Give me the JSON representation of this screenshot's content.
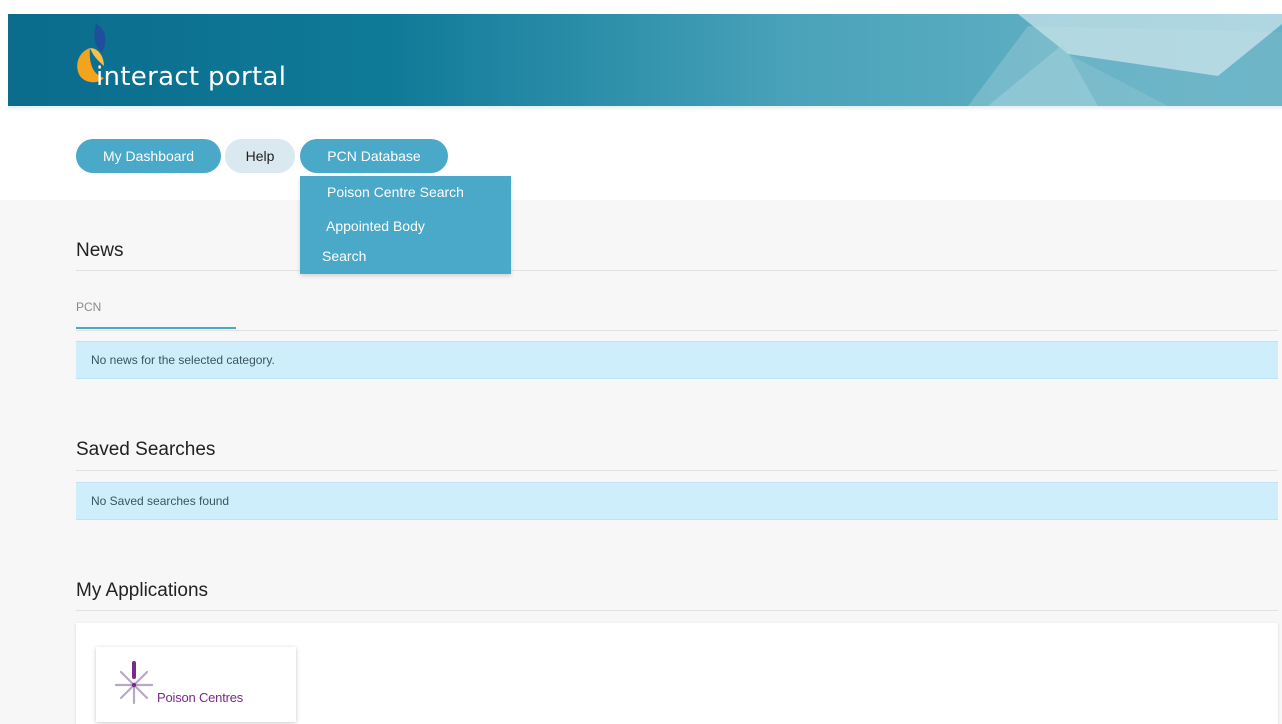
{
  "header": {
    "logo_text": "interact portal",
    "logo_icon": "interact-portal-logo"
  },
  "nav": {
    "items": [
      {
        "label": "My Dashboard"
      },
      {
        "label": "Help"
      },
      {
        "label": "PCN Database"
      }
    ],
    "dropdown": {
      "items": [
        {
          "label": "Poison Centre Search"
        },
        {
          "label": "Appointed Body"
        },
        {
          "label": "Search"
        }
      ]
    }
  },
  "news": {
    "title": "News",
    "tab_label": "PCN",
    "message": "No news for the selected category."
  },
  "saved_searches": {
    "title": "Saved Searches",
    "message": "No Saved searches found"
  },
  "applications": {
    "title": "My Applications",
    "items": [
      {
        "label": "Poison Centres",
        "icon": "poison-centres-logo"
      }
    ]
  },
  "colors": {
    "primary": "#4aa8c9",
    "banner_dark": "#0b6c8d",
    "info_bg": "#cdeefa",
    "app_label": "#7a2a8a"
  }
}
